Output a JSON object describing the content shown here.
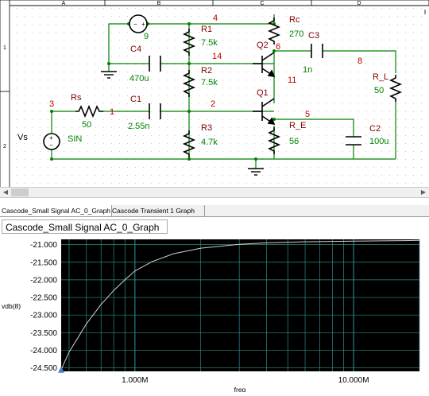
{
  "schematic": {
    "columns": [
      "A",
      "B",
      "C",
      "D"
    ],
    "rows": [
      "1",
      "2"
    ],
    "components": {
      "r1": {
        "name": "R1",
        "value": "7.5k"
      },
      "r2": {
        "name": "R2",
        "value": "7.5k"
      },
      "r3": {
        "name": "R3",
        "value": "4.7k"
      },
      "rc": {
        "name": "Rc",
        "value": "270"
      },
      "re": {
        "name": "R_E",
        "value": "56"
      },
      "rl": {
        "name": "R_L",
        "value": "50"
      },
      "rs": {
        "name": "Rs",
        "value": "50"
      },
      "c1": {
        "name": "C1",
        "value": "2.55n"
      },
      "c2": {
        "name": "C2",
        "value": "100u"
      },
      "c3": {
        "name": "C3",
        "value": "1n"
      },
      "c4": {
        "name": "C4",
        "value": "470u"
      },
      "q1": {
        "name": "Q1"
      },
      "q2": {
        "name": "Q2"
      },
      "vs": {
        "name": "Vs",
        "value": "SIN"
      }
    },
    "nodes": {
      "n1": "1",
      "n2": "2",
      "n3": "3",
      "n4": "4",
      "n5": "5",
      "n6": "6",
      "n8": "8",
      "n9": "9",
      "n11": "11",
      "n14": "14"
    }
  },
  "tabs": [
    {
      "label": "Cascode_Small Signal AC_0_Graph",
      "active": true
    },
    {
      "label": "Cascode  Transient  1  Graph",
      "active": false
    }
  ],
  "graph": {
    "title": "Cascode_Small Signal AC_0_Graph"
  },
  "chart_data": {
    "type": "line",
    "title": "Cascode_Small Signal AC_0_Graph",
    "ylabel": "vdb(8)",
    "xlabel": "freq",
    "x_scale": "log",
    "xlim": [
      460000,
      20000000
    ],
    "ylim": [
      -24.6,
      -20.85
    ],
    "xticks": [
      {
        "value": 1000000,
        "label": "1.000M"
      },
      {
        "value": 10000000,
        "label": "10.000M"
      }
    ],
    "yticks": [
      {
        "value": -21.0,
        "label": "-21.000"
      },
      {
        "value": -21.5,
        "label": "-21.500"
      },
      {
        "value": -22.0,
        "label": "-22.000"
      },
      {
        "value": -22.5,
        "label": "-22.500"
      },
      {
        "value": -23.0,
        "label": "-23.000"
      },
      {
        "value": -23.5,
        "label": "-23.500"
      },
      {
        "value": -24.0,
        "label": "-24.000"
      },
      {
        "value": -24.5,
        "label": "-24.500"
      }
    ],
    "grid": true,
    "background": "#000000",
    "grid_color": "#2a8c8c",
    "trace_color": "#d0d0d0",
    "series": [
      {
        "x": [
          460000,
          500000,
          600000,
          700000,
          800000,
          900000,
          1000000,
          1200000,
          1500000,
          2000000,
          3000000,
          4000000,
          6000000,
          10000000,
          15000000,
          20000000
        ],
        "values": [
          -24.55,
          -24.05,
          -23.25,
          -22.7,
          -22.3,
          -22.0,
          -21.75,
          -21.48,
          -21.26,
          -21.1,
          -20.99,
          -20.95,
          -20.92,
          -20.9,
          -20.89,
          -20.88
        ]
      }
    ]
  },
  "colors": {
    "wire": "#008000",
    "part": "#000000",
    "name_text": "#800000",
    "value_text": "#008000",
    "node_text": "#c00000",
    "grid_dot": "#c0c0c0"
  }
}
